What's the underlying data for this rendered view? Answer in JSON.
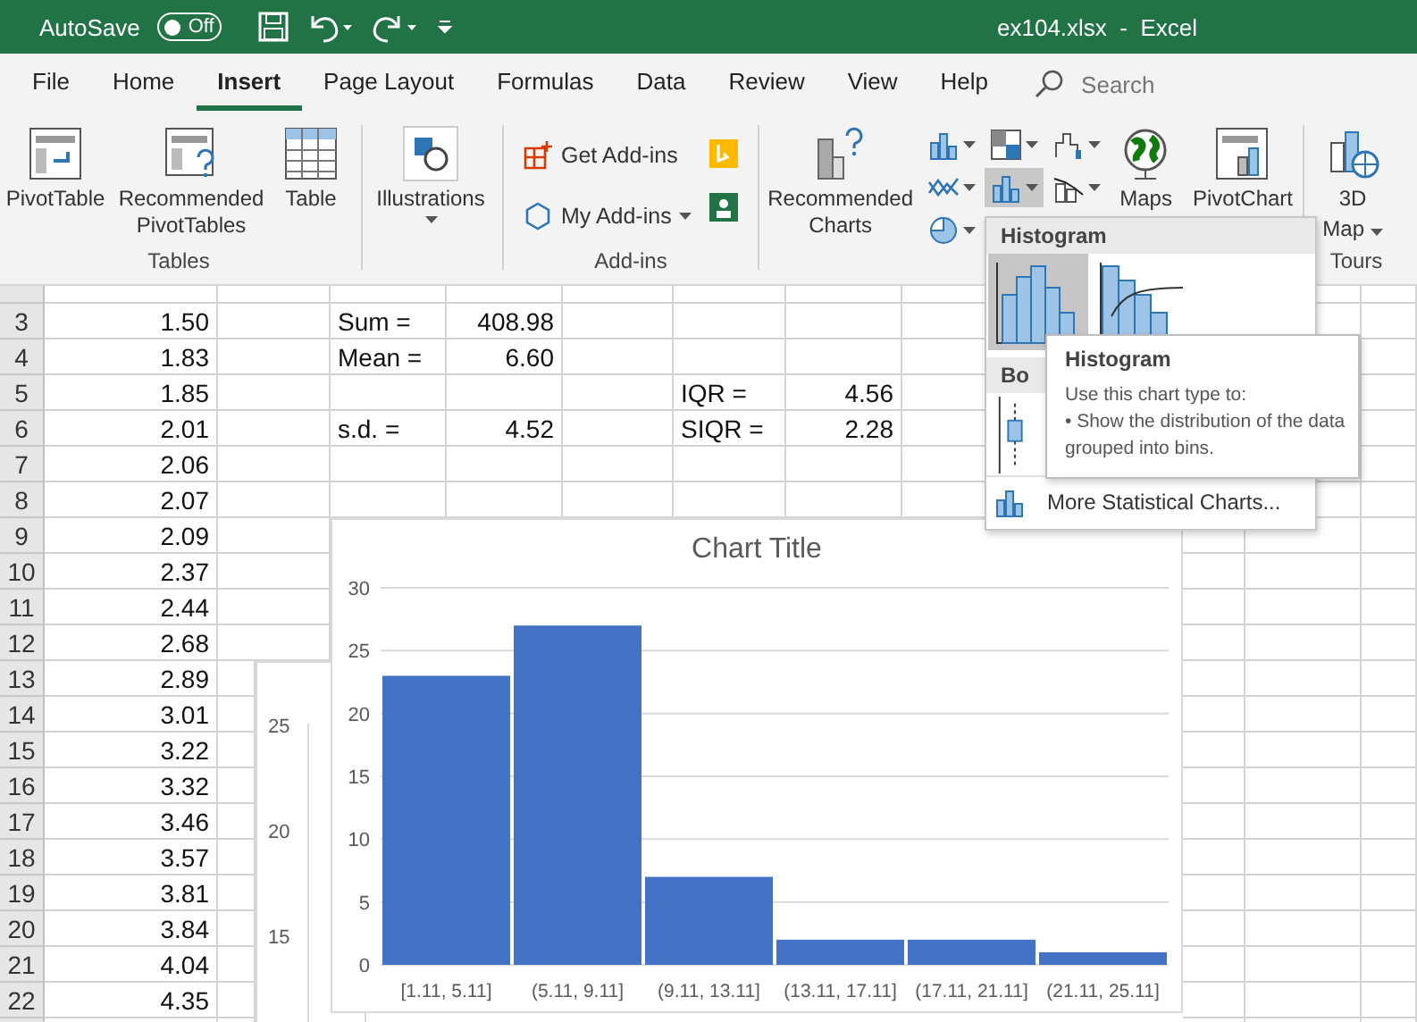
{
  "title_bar": {
    "autosave_label": "AutoSave",
    "autosave_on": false,
    "autosave_state": "Off",
    "document": "ex104.xlsx  -  Excel"
  },
  "tabs": [
    {
      "label": "File",
      "selected": false
    },
    {
      "label": "Home",
      "selected": false
    },
    {
      "label": "Insert",
      "selected": true
    },
    {
      "label": "Page Layout",
      "selected": false
    },
    {
      "label": "Formulas",
      "selected": false
    },
    {
      "label": "Data",
      "selected": false
    },
    {
      "label": "Review",
      "selected": false
    },
    {
      "label": "View",
      "selected": false
    },
    {
      "label": "Help",
      "selected": false
    }
  ],
  "search": {
    "placeholder": "Search"
  },
  "ribbon": {
    "tables": {
      "label": "Tables",
      "pivot_table": "PivotTable",
      "recommended_pivot_tables": "Recommended PivotTables",
      "table": "Table"
    },
    "illustrations": {
      "button": "Illustrations"
    },
    "add_ins": {
      "label": "Add-ins",
      "get_add_ins": "Get Add-ins",
      "my_add_ins": "My Add-ins"
    },
    "charts": {
      "recommended_charts": "Recommended Charts",
      "histogram_selected": true,
      "maps": "Maps",
      "pivot_chart": "PivotChart"
    },
    "tours": {
      "label": "Tours",
      "map_3d_top": "3D",
      "map_3d_bottom": "Map"
    }
  },
  "sheet": {
    "rows": [
      {
        "num": "3",
        "cells": {
          "B": "1.50",
          "D": "Sum =",
          "E": "408.98"
        }
      },
      {
        "num": "4",
        "cells": {
          "B": "1.83",
          "D": "Mean =",
          "E": "6.60"
        }
      },
      {
        "num": "5",
        "cells": {
          "B": "1.85",
          "G": "IQR =",
          "H": "4.56"
        }
      },
      {
        "num": "6",
        "cells": {
          "B": "2.01",
          "D": "s.d. =",
          "E": "4.52",
          "G": "SIQR =",
          "H": "2.28"
        }
      },
      {
        "num": "7",
        "cells": {
          "B": "2.06"
        }
      },
      {
        "num": "8",
        "cells": {
          "B": "2.07"
        }
      },
      {
        "num": "9",
        "cells": {
          "B": "2.09"
        }
      },
      {
        "num": "10",
        "cells": {
          "B": "2.37"
        }
      },
      {
        "num": "11",
        "cells": {
          "B": "2.44"
        }
      },
      {
        "num": "12",
        "cells": {
          "B": "2.68"
        }
      },
      {
        "num": "13",
        "cells": {
          "B": "2.89"
        }
      },
      {
        "num": "14",
        "cells": {
          "B": "3.01"
        }
      },
      {
        "num": "15",
        "cells": {
          "B": "3.22"
        }
      },
      {
        "num": "16",
        "cells": {
          "B": "3.32"
        }
      },
      {
        "num": "17",
        "cells": {
          "B": "3.46"
        }
      },
      {
        "num": "18",
        "cells": {
          "B": "3.57"
        }
      },
      {
        "num": "19",
        "cells": {
          "B": "3.81"
        }
      },
      {
        "num": "20",
        "cells": {
          "B": "3.84"
        }
      },
      {
        "num": "21",
        "cells": {
          "B": "4.04"
        }
      },
      {
        "num": "22",
        "cells": {
          "B": "4.35"
        }
      }
    ]
  },
  "background_chart": {
    "tick_labels": [
      "25",
      "20",
      "15"
    ]
  },
  "chart": {
    "chart_data": {
      "type": "bar",
      "title": "Chart Title",
      "categories": [
        "[1.11, 5.11]",
        "(5.11, 9.11]",
        "(9.11, 13.11]",
        "(13.11, 17.11]",
        "(17.11, 21.11]",
        "(21.11, 25.11]"
      ],
      "values": [
        23,
        27,
        7,
        2,
        2,
        1
      ],
      "ylim": [
        0,
        30
      ],
      "yticks": [
        0,
        5,
        10,
        15,
        20,
        25,
        30
      ],
      "grid": true
    }
  },
  "chart_menu": {
    "section_1": "Histogram",
    "thumbnails": [
      {
        "kind": "histogram",
        "selected": true
      },
      {
        "kind": "pareto",
        "selected": false
      }
    ],
    "section_2": "Bo",
    "more": "More Statistical Charts..."
  },
  "tooltip": {
    "title": "Histogram",
    "lines": [
      "Use this chart type to:",
      "• Show the distribution of the data",
      "grouped into bins."
    ]
  }
}
